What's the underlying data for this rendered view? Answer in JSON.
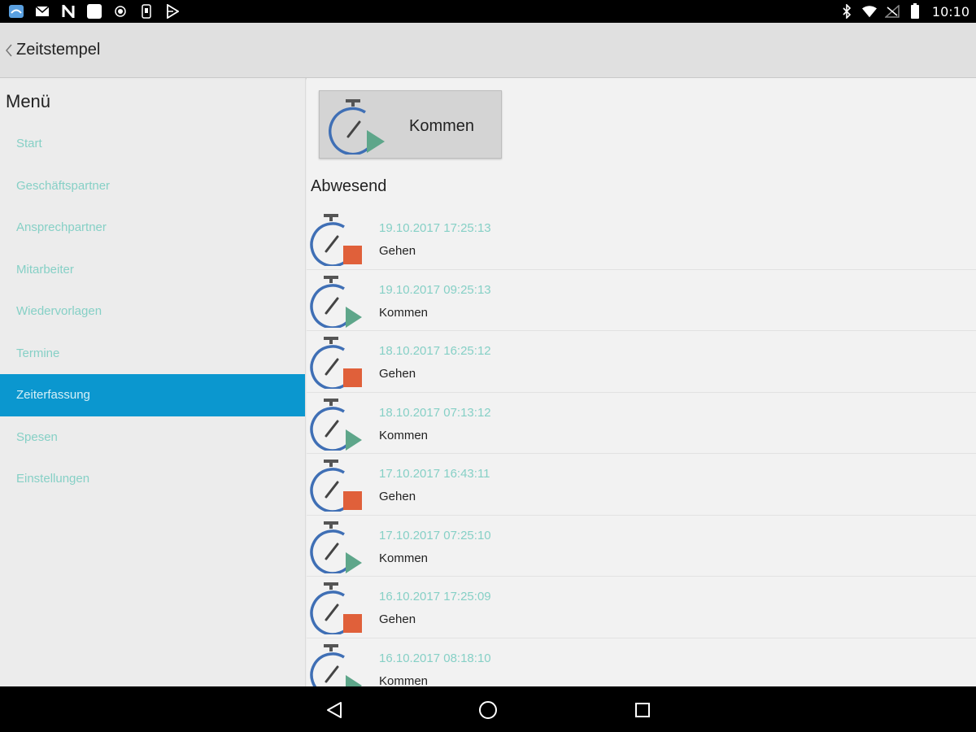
{
  "status_bar": {
    "time": "10:10",
    "left_icons": [
      "app-icon",
      "mail-icon",
      "n-icon",
      "square-app-icon",
      "record-icon",
      "sim-icon",
      "play-store-icon"
    ],
    "right_icons": [
      "bluetooth-icon",
      "wifi-icon",
      "signal-off-icon",
      "battery-icon"
    ]
  },
  "app_bar": {
    "title": "Zeitstempel",
    "back_icon": "chevron-left-icon"
  },
  "sidebar": {
    "title": "Menü",
    "items": [
      {
        "label": "Start",
        "active": false
      },
      {
        "label": "Geschäftspartner",
        "active": false
      },
      {
        "label": "Ansprechpartner",
        "active": false
      },
      {
        "label": "Mitarbeiter",
        "active": false
      },
      {
        "label": "Wiedervorlagen",
        "active": false
      },
      {
        "label": "Termine",
        "active": false
      },
      {
        "label": "Zeiterfassung",
        "active": true
      },
      {
        "label": "Spesen",
        "active": false
      },
      {
        "label": "Einstellungen",
        "active": false
      }
    ]
  },
  "main": {
    "action_button": {
      "label": "Kommen",
      "icon": "stopwatch-play-icon"
    },
    "status_heading": "Abwesend",
    "entries": [
      {
        "timestamp": "19.10.2017 17:25:13",
        "type": "Gehen",
        "icon": "stopwatch-stop-icon"
      },
      {
        "timestamp": "19.10.2017 09:25:13",
        "type": "Kommen",
        "icon": "stopwatch-play-icon"
      },
      {
        "timestamp": "18.10.2017 16:25:12",
        "type": "Gehen",
        "icon": "stopwatch-stop-icon"
      },
      {
        "timestamp": "18.10.2017 07:13:12",
        "type": "Kommen",
        "icon": "stopwatch-play-icon"
      },
      {
        "timestamp": "17.10.2017 16:43:11",
        "type": "Gehen",
        "icon": "stopwatch-stop-icon"
      },
      {
        "timestamp": "17.10.2017 07:25:10",
        "type": "Kommen",
        "icon": "stopwatch-play-icon"
      },
      {
        "timestamp": "16.10.2017 17:25:09",
        "type": "Gehen",
        "icon": "stopwatch-stop-icon"
      },
      {
        "timestamp": "16.10.2017 08:18:10",
        "type": "Kommen",
        "icon": "stopwatch-play-icon"
      }
    ]
  },
  "nav_bar": {
    "buttons": [
      "back-triangle-icon",
      "home-circle-icon",
      "recents-square-icon"
    ]
  },
  "colors": {
    "accent": "#0b97cf",
    "link_text": "#86d0c6",
    "stopwatch_blue": "#3f6fb5",
    "play_green": "#5ea68a",
    "stop_orange": "#e0603a"
  }
}
